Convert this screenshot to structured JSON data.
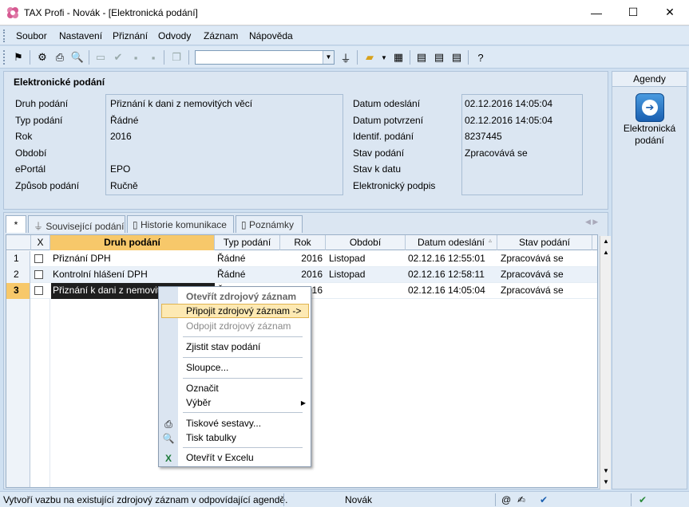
{
  "window": {
    "title": "TAX Profi - Novák - [Elektronická podání]",
    "minimize": "—",
    "maximize": "☐",
    "close": "✕"
  },
  "menu": [
    {
      "label": "Soubor"
    },
    {
      "label": "Nastavení"
    },
    {
      "label": "Přiznání"
    },
    {
      "label": "Odvody"
    },
    {
      "label": "Záznam"
    },
    {
      "label": "Nápověda"
    }
  ],
  "toolbar": {
    "combo_value": ""
  },
  "detail": {
    "heading": "Elektronické podání",
    "left_labels": [
      "Druh podání",
      "Typ podání",
      "Rok",
      "Období",
      "ePortál",
      "Způsob podání"
    ],
    "left_values": [
      "Přiznání k dani z nemovitých věcí",
      "Řádné",
      "2016",
      "",
      "EPO",
      "Ručně"
    ],
    "right_labels": [
      "Datum odeslání",
      "Datum potvrzení",
      "Identif. podání",
      "Stav podání",
      "Stav k datu",
      "Elektronický podpis"
    ],
    "right_values": [
      "02.12.2016 14:05:04",
      "02.12.2016 14:05:04",
      "8237445",
      "Zpracovává se",
      "",
      ""
    ]
  },
  "tabs": [
    {
      "label": "*"
    },
    {
      "label": "Související podání"
    },
    {
      "label": "Historie komunikace"
    },
    {
      "label": "Poznámky"
    }
  ],
  "grid": {
    "columns": [
      "X",
      "Druh podání",
      "Typ podání",
      "Rok",
      "Období",
      "Datum odeslání",
      "Stav podání"
    ],
    "rows": [
      {
        "num": "1",
        "druh": "Přiznání DPH",
        "typ": "Řádné",
        "rok": "2016",
        "obdobi": "Listopad",
        "datum": "02.12.16 12:55:01",
        "stav": "Zpracovává se"
      },
      {
        "num": "2",
        "druh": "Kontrolní hlášení DPH",
        "typ": "Řádné",
        "rok": "2016",
        "obdobi": "Listopad",
        "datum": "02.12.16 12:58:11",
        "stav": "Zpracovává se"
      },
      {
        "num": "3",
        "druh": "Přiznání k dani z nemovitých věcí",
        "typ": "Řádné",
        "rok": "2016",
        "obdobi": "",
        "datum": "02.12.16 14:05:04",
        "stav": "Zpracovává se"
      }
    ]
  },
  "context_menu": {
    "items": [
      "Otevřít zdrojový záznam",
      "Připojit zdrojový záznam ->",
      "Odpojit zdrojový záznam",
      "Zjistit stav podání",
      "Sloupce...",
      "Označit",
      "Výběr",
      "Tiskové sestavy...",
      "Tisk tabulky",
      "Otevřít v Excelu"
    ]
  },
  "agenda": {
    "header": "Agendy",
    "item_label": "Elektronická podání"
  },
  "status": {
    "message": "Vytvoří vazbu na existující zdrojový záznam v odpovídající agendě.",
    "user": "Novák",
    "at_symbol": "@"
  },
  "colors": {
    "accent": "#f7c86a",
    "selection": "#1e1e1e",
    "panel": "#dbe6f2",
    "menu_highlight": "#fde9b3"
  }
}
